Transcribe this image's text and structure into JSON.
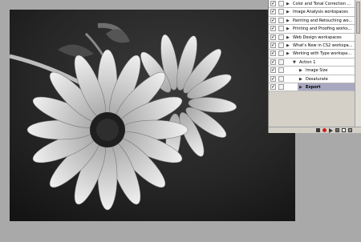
{
  "actions_panel": {
    "items": [
      {
        "label": "Color and Tonal Correction ...",
        "level": 0,
        "expanded": false,
        "selected": false
      },
      {
        "label": "Image Analysis workspaces",
        "level": 0,
        "expanded": false,
        "selected": false
      },
      {
        "label": "Painting and Retouching wo...",
        "level": 0,
        "expanded": false,
        "selected": false
      },
      {
        "label": "Printing and Proofing works...",
        "level": 0,
        "expanded": false,
        "selected": false
      },
      {
        "label": "Web Design workspaces",
        "level": 0,
        "expanded": false,
        "selected": false
      },
      {
        "label": "What's New in CS2 workspa...",
        "level": 0,
        "expanded": false,
        "selected": false
      },
      {
        "label": "Working with Type workspa...",
        "level": 0,
        "expanded": false,
        "selected": false
      },
      {
        "label": "Action 1",
        "level": 1,
        "expanded": true,
        "selected": false
      },
      {
        "label": "Image Size",
        "level": 2,
        "expanded": false,
        "selected": false
      },
      {
        "label": "Desaturate",
        "level": 2,
        "expanded": false,
        "selected": false
      },
      {
        "label": "Export",
        "level": 2,
        "expanded": false,
        "selected": true
      }
    ],
    "toolbar": [
      "stop-icon",
      "record-icon",
      "play-icon",
      "new-set-icon",
      "new-action-icon",
      "trash-icon"
    ]
  },
  "colors": {
    "workspace": "#a9a9a9",
    "panel": "#d4d0c8",
    "selection": "#a8a8c0",
    "record": "#d0201b"
  }
}
